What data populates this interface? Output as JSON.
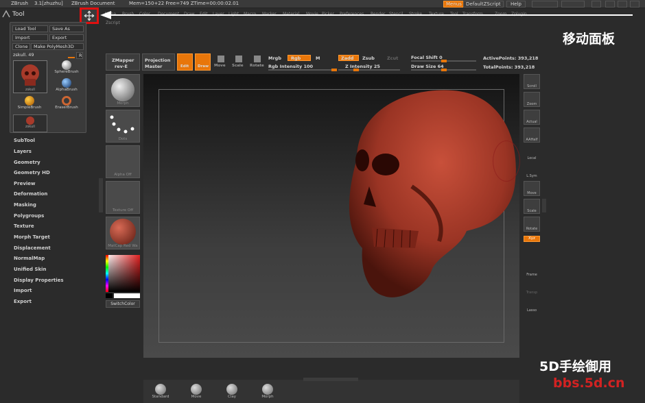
{
  "topbar": {
    "app": "ZBrush",
    "version": "3.1[zhuzhu]",
    "document": "ZBrush Document",
    "mem": "Mem=150+22 Free=749 ZTime=00:00:02.01",
    "menus_label": "Menus",
    "script_label": "DefaultZScript",
    "help_label": "Help"
  },
  "menubar": [
    "Alpha",
    "Brush",
    "Color",
    "Document",
    "Draw",
    "Edit",
    "Layer",
    "Light",
    "Macro",
    "Marker",
    "Material",
    "Movie",
    "Picker",
    "Preferences",
    "Render",
    "Stencil",
    "Stroke",
    "Texture",
    "Tool",
    "Transform",
    "Zoom",
    "Zplugin",
    "Zscript"
  ],
  "tool_panel": {
    "title": "Tool",
    "load_tool": "Load Tool",
    "save_as": "Save As",
    "import": "Import",
    "export": "Export",
    "clone": "Clone",
    "make_polymesh": "Make PolyMesh3D",
    "current_tool": "zskull. 49",
    "r_label": "R",
    "tools": [
      {
        "name": "zskull",
        "icon": "skull-icon"
      },
      {
        "name": "SphereBrush",
        "icon": "sphere-brush-icon"
      },
      {
        "name": "AlphaBrush",
        "icon": "alpha-brush-icon"
      },
      {
        "name": "SimpleBrush",
        "icon": "simple-brush-icon"
      },
      {
        "name": "EraserBrush",
        "icon": "eraser-brush-icon"
      },
      {
        "name": "zskull",
        "icon": "skull-icon"
      }
    ]
  },
  "left_menu": [
    "SubTool",
    "Layers",
    "Geometry",
    "Geometry HD",
    "Preview",
    "Deformation",
    "Masking",
    "Polygroups",
    "Texture",
    "Morph Target",
    "Displacement",
    "NormalMap",
    "Unified Skin",
    "Display Properties",
    "Import",
    "Export"
  ],
  "annotation": {
    "move_panel": "移动面板",
    "watermark_cn": "5D手绘御用",
    "watermark_url": "bbs.5d.cn"
  },
  "toolbar": {
    "zmapper": "ZMapper",
    "zmapper_sub": "rev-E",
    "projection": "Projection",
    "projection_sub": "Master",
    "edit": "Edit",
    "draw": "Draw",
    "move": "Move",
    "scale": "Scale",
    "rotate": "Rotate",
    "mrgb": "Mrgb",
    "rgb": "Rgb",
    "m": "M",
    "rgb_intensity": "Rgb Intensity 100",
    "zadd": "Zadd",
    "zsub": "Zsub",
    "zcut": "Zcut",
    "z_intensity": "Z Intensity 25",
    "focal_shift": "Focal Shift 0",
    "draw_size": "Draw Size 64",
    "active_points": "ActivePoints: 393,218",
    "total_points": "TotalPoints: 393,218"
  },
  "left_shelf": {
    "morph": "Morph",
    "dots": "Dots",
    "alpha_off": "Alpha Off",
    "texture_off": "Texture Off",
    "matcap": "MatCap Red Wa",
    "switch_color": "SwitchColor"
  },
  "right_shelf": [
    "Scroll",
    "Zoom",
    "Actual",
    "AAHalf",
    "Local",
    "L.Sym",
    "Move",
    "Scale",
    "Rotate",
    "Frame",
    "Transp",
    "Lasso"
  ],
  "xyz_label": "Xyz",
  "bottom_shelf": [
    "Standard",
    "Move",
    "Clay",
    "Morph"
  ],
  "colors": {
    "accent": "#e8760a",
    "skull": "#a83a2a",
    "watermark": "#d22222"
  }
}
